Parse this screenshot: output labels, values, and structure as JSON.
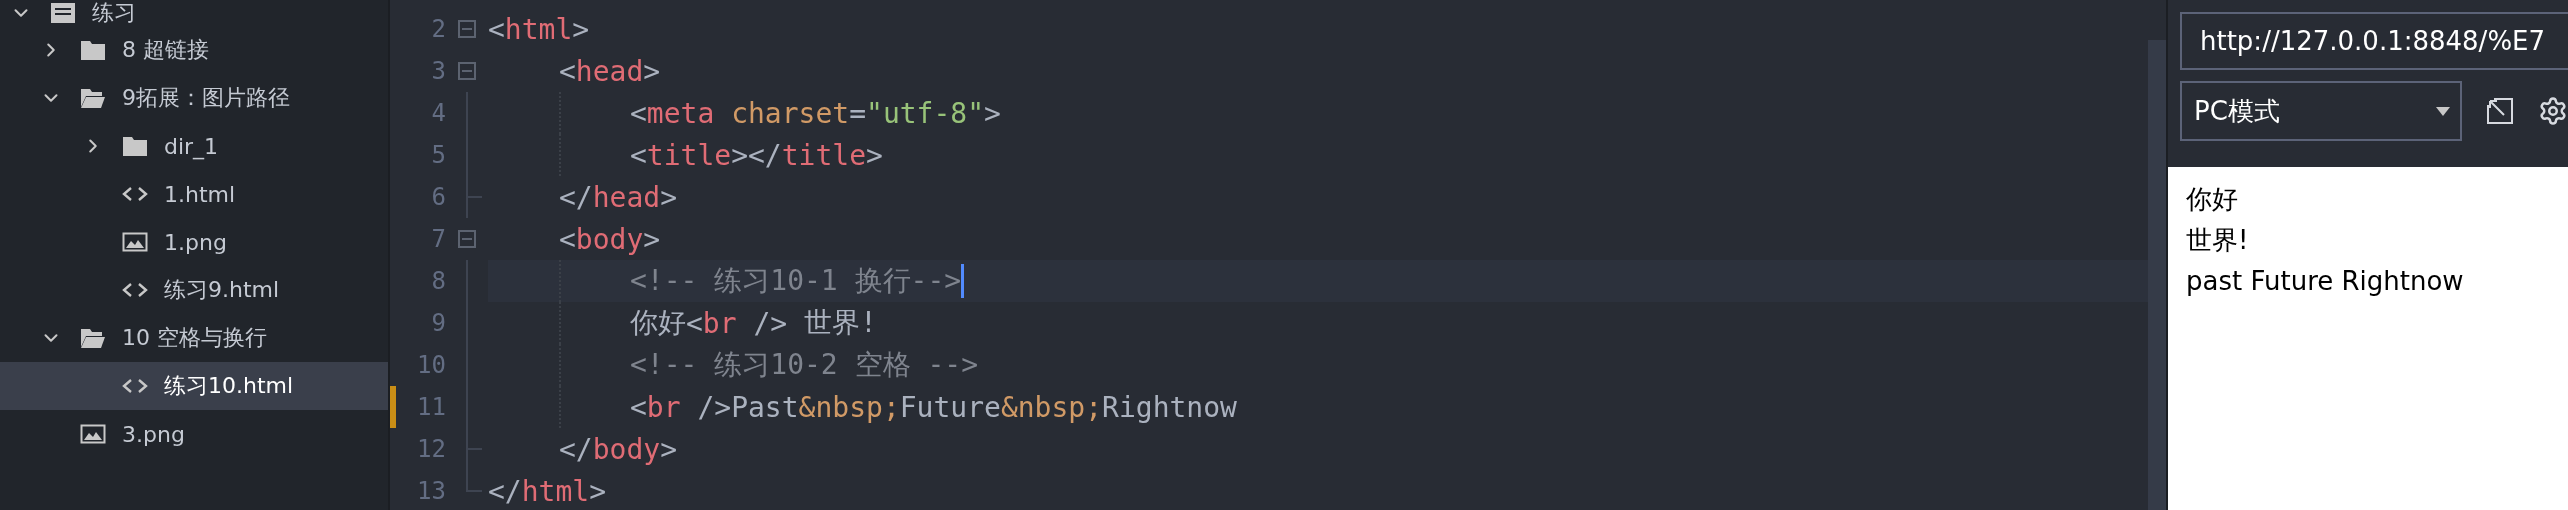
{
  "sidebar": {
    "tree": [
      {
        "label": "练习",
        "kind": "project",
        "expanded": true,
        "selected": false,
        "children": [
          {
            "label": "8 超链接",
            "kind": "folder",
            "expanded": false,
            "selected": false
          },
          {
            "label": "9拓展：图片路径",
            "kind": "folder",
            "expanded": true,
            "selected": false,
            "children": [
              {
                "label": "dir_1",
                "kind": "folder",
                "expanded": false,
                "selected": false
              },
              {
                "label": "1.html",
                "kind": "html",
                "selected": false
              },
              {
                "label": "1.png",
                "kind": "image",
                "selected": false
              },
              {
                "label": "练习9.html",
                "kind": "html",
                "selected": false
              }
            ]
          },
          {
            "label": "10 空格与换行",
            "kind": "folder",
            "expanded": true,
            "selected": false,
            "children": [
              {
                "label": "练习10.html",
                "kind": "html",
                "selected": true
              }
            ]
          },
          {
            "label": "3.png",
            "kind": "image",
            "selected": false
          }
        ]
      }
    ]
  },
  "editor": {
    "lines": [
      {
        "number": "2",
        "kind": "fold-start",
        "current": false,
        "modified": false,
        "tokens": [
          {
            "kind": "punct",
            "text": "<"
          },
          {
            "kind": "tag",
            "text": "html"
          },
          {
            "kind": "punct",
            "text": ">"
          }
        ]
      },
      {
        "number": "3",
        "kind": "fold-start",
        "current": false,
        "modified": false,
        "tokens": [
          {
            "kind": "indent"
          },
          {
            "kind": "punct",
            "text": "<"
          },
          {
            "kind": "tag",
            "text": "head"
          },
          {
            "kind": "punct",
            "text": ">"
          }
        ]
      },
      {
        "number": "4",
        "kind": "fold-body",
        "current": false,
        "modified": false,
        "tokens": [
          {
            "kind": "indent"
          },
          {
            "kind": "guide"
          },
          {
            "kind": "punct",
            "text": "<"
          },
          {
            "kind": "tag",
            "text": "meta "
          },
          {
            "kind": "attr",
            "text": "charset"
          },
          {
            "kind": "punct",
            "text": "="
          },
          {
            "kind": "string",
            "text": "\"utf-8\""
          },
          {
            "kind": "punct",
            "text": ">"
          }
        ]
      },
      {
        "number": "5",
        "kind": "fold-body",
        "current": false,
        "modified": false,
        "tokens": [
          {
            "kind": "indent"
          },
          {
            "kind": "guide"
          },
          {
            "kind": "punct",
            "text": "<"
          },
          {
            "kind": "tag",
            "text": "title"
          },
          {
            "kind": "punct",
            "text": "></"
          },
          {
            "kind": "tag",
            "text": "title"
          },
          {
            "kind": "punct",
            "text": ">"
          }
        ]
      },
      {
        "number": "6",
        "kind": "fold-close",
        "current": false,
        "modified": false,
        "tokens": [
          {
            "kind": "indent"
          },
          {
            "kind": "punct",
            "text": "</"
          },
          {
            "kind": "tag",
            "text": "head"
          },
          {
            "kind": "punct",
            "text": ">"
          }
        ]
      },
      {
        "number": "7",
        "kind": "fold-start",
        "current": false,
        "modified": false,
        "tokens": [
          {
            "kind": "indent"
          },
          {
            "kind": "punct",
            "text": "<"
          },
          {
            "kind": "tag",
            "text": "body"
          },
          {
            "kind": "punct",
            "text": ">"
          }
        ]
      },
      {
        "number": "8",
        "kind": "fold-body",
        "current": true,
        "modified": false,
        "tokens": [
          {
            "kind": "indent"
          },
          {
            "kind": "guide"
          },
          {
            "kind": "comment",
            "text": "<!-- 练习10-1 换行-->"
          }
        ]
      },
      {
        "number": "9",
        "kind": "fold-body",
        "current": false,
        "modified": false,
        "tokens": [
          {
            "kind": "indent"
          },
          {
            "kind": "guide"
          },
          {
            "kind": "text",
            "text": "你好"
          },
          {
            "kind": "punct",
            "text": "<"
          },
          {
            "kind": "tag",
            "text": "br"
          },
          {
            "kind": "punct",
            "text": " /> "
          },
          {
            "kind": "text",
            "text": "世界!"
          }
        ]
      },
      {
        "number": "10",
        "kind": "fold-body",
        "current": false,
        "modified": false,
        "tokens": [
          {
            "kind": "indent"
          },
          {
            "kind": "guide"
          },
          {
            "kind": "comment",
            "text": "<!-- 练习10-2 空格 -->"
          }
        ]
      },
      {
        "number": "11",
        "kind": "fold-body",
        "current": false,
        "modified": true,
        "tokens": [
          {
            "kind": "indent"
          },
          {
            "kind": "guide"
          },
          {
            "kind": "punct",
            "text": "<"
          },
          {
            "kind": "tag",
            "text": "br"
          },
          {
            "kind": "punct",
            "text": " />"
          },
          {
            "kind": "text",
            "text": "Past"
          },
          {
            "kind": "entity",
            "text": "&nbsp;"
          },
          {
            "kind": "text",
            "text": "Future"
          },
          {
            "kind": "entity",
            "text": "&nbsp;"
          },
          {
            "kind": "text",
            "text": "Rightnow"
          }
        ]
      },
      {
        "number": "12",
        "kind": "fold-close",
        "current": false,
        "modified": false,
        "tokens": [
          {
            "kind": "indent"
          },
          {
            "kind": "punct",
            "text": "</"
          },
          {
            "kind": "tag",
            "text": "body"
          },
          {
            "kind": "punct",
            "text": ">"
          }
        ]
      },
      {
        "number": "13",
        "kind": "fold-end",
        "current": false,
        "modified": false,
        "tokens": [
          {
            "kind": "punct",
            "text": "</"
          },
          {
            "kind": "tag",
            "text": "html"
          },
          {
            "kind": "punct",
            "text": ">"
          }
        ]
      }
    ]
  },
  "browser": {
    "url": "http://127.0.0.1:8848/%E7",
    "mode": "PC模式",
    "preview": [
      "你好",
      "世界!",
      "past Future Rightnow"
    ]
  }
}
